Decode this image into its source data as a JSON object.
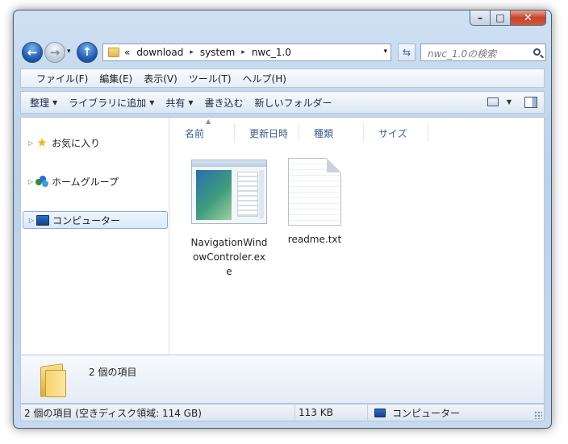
{
  "window": {
    "caption": {
      "minimize": "–",
      "maximize": "□",
      "close": "✕"
    }
  },
  "nav": {
    "history_drop": "▾",
    "breadcrumb": {
      "chevrons": "«",
      "parts": [
        "download",
        "system",
        "nwc_1.0"
      ],
      "separator": "▸"
    },
    "address_drop": "▾",
    "refresh": "⇆",
    "search_placeholder": "nwc_1.0の検索"
  },
  "menubar": [
    "ファイル(F)",
    "編集(E)",
    "表示(V)",
    "ツール(T)",
    "ヘルプ(H)"
  ],
  "commandbar": {
    "organize": "整理",
    "add_to_library": "ライブラリに追加",
    "share": "共有",
    "burn": "書き込む",
    "new_folder": "新しいフォルダー",
    "caret": "▼"
  },
  "navpane": {
    "favorites": "お気に入り",
    "homegroup": "ホームグループ",
    "computer": "コンピューター",
    "expander": "▷"
  },
  "columns": [
    "名前",
    "更新日時",
    "種類",
    "サイズ"
  ],
  "sort_indicator": "▲",
  "files": [
    {
      "name_line1": "NavigationWind",
      "name_line2": "owControler.ex",
      "name_line3": "e",
      "icon": "exe-icon"
    },
    {
      "name_line1": "readme.txt",
      "icon": "text-file-icon"
    }
  ],
  "details": {
    "count": "2 個の項目"
  },
  "statusbar": {
    "items": "2 個の項目 (空きディスク領域: 114 GB)",
    "size": "113 KB",
    "location": "コンピューター"
  },
  "colors": {
    "accent": "#1f5fb3",
    "column_header": "#3a5e8d",
    "frame": "#b9d1ea"
  }
}
